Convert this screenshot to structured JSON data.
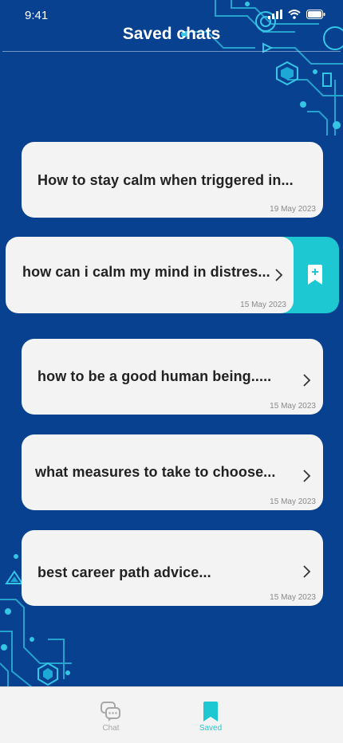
{
  "status_bar": {
    "time": "9:41",
    "icons": [
      "signal-icon",
      "wifi-icon",
      "battery-icon"
    ]
  },
  "header": {
    "title": "Saved chats"
  },
  "chats": [
    {
      "title": "How to stay calm when triggered in...",
      "date": "19 May 2023",
      "has_chevron": false
    },
    {
      "title": "how can i calm my mind in distres...",
      "date": "15 May 2023",
      "has_chevron": true,
      "swiped": true
    },
    {
      "title": "how to be a good human being.....",
      "date": "15 May 2023",
      "has_chevron": true
    },
    {
      "title": "what measures to take to choose...",
      "date": "15 May 2023",
      "has_chevron": true
    },
    {
      "title": "best career path advice...",
      "date": "15 May 2023",
      "has_chevron": true
    }
  ],
  "swipe_action": {
    "icon": "bookmark-plus-icon"
  },
  "tab_bar": {
    "tabs": [
      {
        "label": "Chat",
        "icon": "chat-bubbles-icon",
        "active": false
      },
      {
        "label": "Saved",
        "icon": "bookmark-icon",
        "active": true
      }
    ]
  },
  "colors": {
    "background": "#08418f",
    "card": "#f3f3f3",
    "accent": "#1ec8d3",
    "text_dark": "#222222",
    "date_text": "#8a8a8a",
    "tab_inactive": "#a7a7a7"
  }
}
